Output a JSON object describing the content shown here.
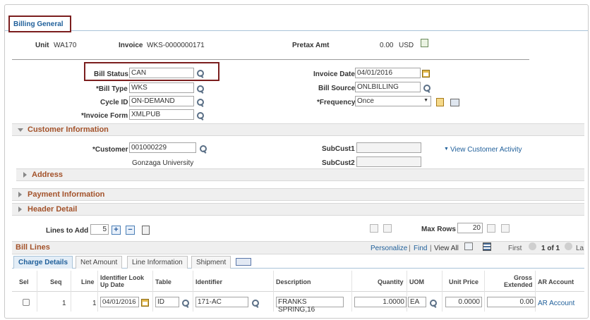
{
  "tabs": {
    "billing_general": "Billing General"
  },
  "header": {
    "unit_label": "Unit",
    "unit_value": "WA170",
    "invoice_label": "Invoice",
    "invoice_value": "WKS-0000000171",
    "pretax_label": "Pretax Amt",
    "pretax_value": "0.00",
    "pretax_currency": "USD"
  },
  "form": {
    "bill_status_label": "Bill Status",
    "bill_status_value": "CAN",
    "bill_type_label": "*Bill Type",
    "bill_type_value": "WKS",
    "cycle_id_label": "Cycle ID",
    "cycle_id_value": "ON-DEMAND",
    "invoice_form_label": "*Invoice Form",
    "invoice_form_value": "XMLPUB",
    "invoice_date_label": "Invoice Date",
    "invoice_date_value": "04/01/2016",
    "bill_source_label": "Bill Source",
    "bill_source_value": "ONLBILLING",
    "frequency_label": "*Frequency",
    "frequency_value": "Once"
  },
  "customer": {
    "section_title": "Customer Information",
    "customer_label": "*Customer",
    "customer_value": "001000229",
    "customer_name": "Gonzaga University",
    "subcust1_label": "SubCust1",
    "subcust2_label": "SubCust2",
    "view_activity": "View Customer Activity",
    "address_title": "Address"
  },
  "sections": {
    "payment": "Payment Information",
    "header_detail": "Header Detail"
  },
  "lines_controls": {
    "lines_to_add_label": "Lines to Add",
    "lines_to_add_value": "5",
    "max_rows_label": "Max Rows",
    "max_rows_value": "20"
  },
  "bill_lines": {
    "title": "Bill Lines",
    "personalize": "Personalize",
    "find": "Find",
    "view_all": "View All",
    "sep1": "|",
    "sep2": "|",
    "first": "First",
    "range": "1 of 1",
    "last": "La",
    "subtabs": [
      "Charge Details",
      "Net Amount",
      "Line Information",
      "Shipment"
    ],
    "columns": {
      "sel": "Sel",
      "seq": "Seq",
      "line": "Line",
      "identifier_lookup": "Identifier Look Up Date",
      "table": "Table",
      "identifier": "Identifier",
      "description": "Description",
      "quantity": "Quantity",
      "uom": "UOM",
      "unit_price": "Unit Price",
      "gross_extended": "Gross Extended",
      "ar_account": "AR Account"
    },
    "row": {
      "seq": "1",
      "line": "1",
      "lookup_date": "04/01/2016",
      "table": "ID",
      "identifier": "171-AC",
      "description": "FRANKS SPRING,16",
      "quantity": "1.0000",
      "uom": "EA",
      "unit_price": "0.0000",
      "gross_extended": "0.00",
      "ar_account": "AR Account"
    }
  },
  "colors": {
    "accent": "#1f5f9a",
    "section_title": "#a3522a",
    "highlight": "#7b1e1e"
  }
}
